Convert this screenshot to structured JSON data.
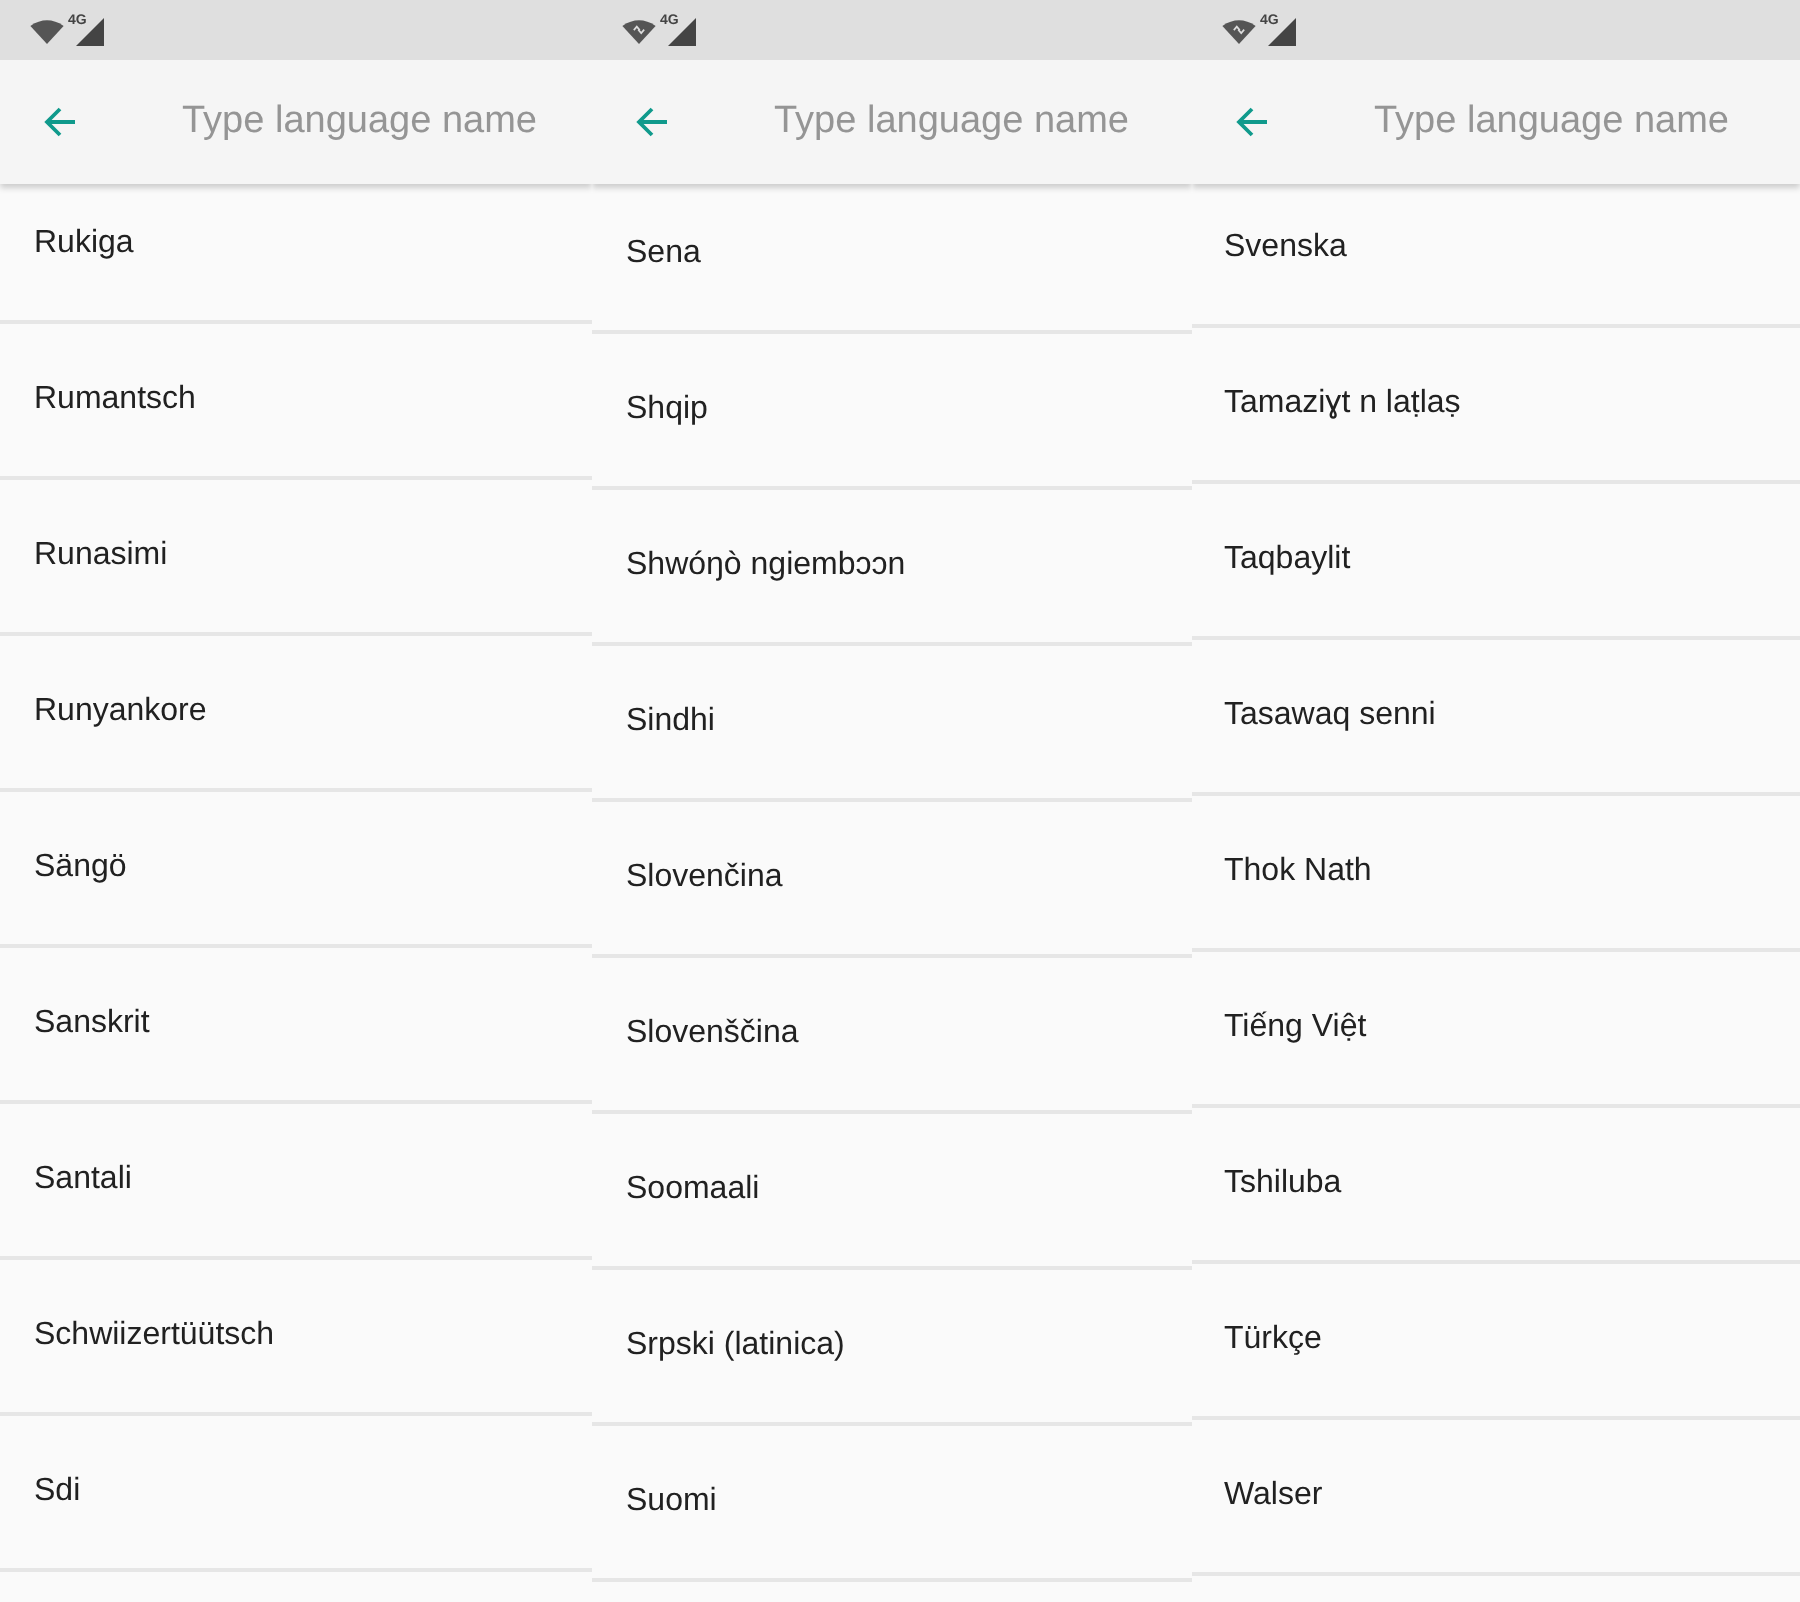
{
  "screens": [
    {
      "status_bar": {
        "wifi_activity": false,
        "network_type": "4G"
      },
      "search": {
        "placeholder": "Type language name"
      },
      "languages": [
        "Rukiga",
        "Rumantsch",
        "Runasimi",
        "Runyankore",
        "Sängö",
        "Sanskrit",
        "Santali",
        "Schwiizertüütsch",
        "Sdi"
      ]
    },
    {
      "status_bar": {
        "wifi_activity": true,
        "network_type": "4G"
      },
      "search": {
        "placeholder": "Type language name"
      },
      "languages": [
        "Sena",
        "Shqip",
        "Shwóŋò ngiembɔɔn",
        "Sindhi",
        "Slovenčina",
        "Slovenščina",
        "Soomaali",
        "Srpski (latinica)",
        "Suomi"
      ]
    },
    {
      "status_bar": {
        "wifi_activity": true,
        "network_type": "4G"
      },
      "search": {
        "placeholder": "Type language name"
      },
      "languages": [
        "Svenska",
        "Tamaziɣt n laṭlaṣ",
        "Taqbaylit",
        "Tasawaq senni",
        "Thok Nath",
        "Tiếng Việt",
        "Tshiluba",
        "Türkçe",
        "Walser"
      ]
    }
  ]
}
